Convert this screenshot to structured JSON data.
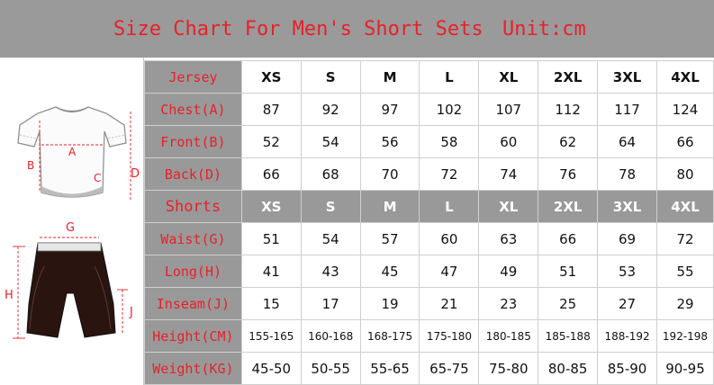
{
  "banner": {
    "title": "Size Chart For Men's Short Sets",
    "unit": "Unit:cm"
  },
  "illustration": {
    "jersey_labels": [
      "A",
      "B",
      "C",
      "D"
    ],
    "shorts_labels": [
      "G",
      "H",
      "J"
    ]
  },
  "table": {
    "jersey_header": "Jersey",
    "sizes": [
      "XS",
      "S",
      "M",
      "L",
      "XL",
      "2XL",
      "3XL",
      "4XL"
    ],
    "jersey_rows": [
      {
        "label": "Chest(A)",
        "values": [
          "87",
          "92",
          "97",
          "102",
          "107",
          "112",
          "117",
          "124"
        ]
      },
      {
        "label": "Front(B)",
        "values": [
          "52",
          "54",
          "56",
          "58",
          "60",
          "62",
          "64",
          "66"
        ]
      },
      {
        "label": "Back(D)",
        "values": [
          "66",
          "68",
          "70",
          "72",
          "74",
          "76",
          "78",
          "80"
        ]
      }
    ],
    "shorts_header": "Shorts",
    "shorts_rows": [
      {
        "label": "Waist(G)",
        "values": [
          "51",
          "54",
          "57",
          "60",
          "63",
          "66",
          "69",
          "72"
        ]
      },
      {
        "label": "Long(H)",
        "values": [
          "41",
          "43",
          "45",
          "47",
          "49",
          "51",
          "53",
          "55"
        ]
      },
      {
        "label": "Inseam(J)",
        "values": [
          "15",
          "17",
          "19",
          "21",
          "23",
          "25",
          "27",
          "29"
        ]
      },
      {
        "label": "Height(CM)",
        "values": [
          "155-165",
          "160-168",
          "168-175",
          "175-180",
          "180-185",
          "185-188",
          "188-192",
          "192-198"
        ]
      },
      {
        "label": "Weight(KG)",
        "values": [
          "45-50",
          "50-55",
          "55-65",
          "65-75",
          "75-80",
          "80-85",
          "85-90",
          "90-95"
        ]
      }
    ]
  }
}
